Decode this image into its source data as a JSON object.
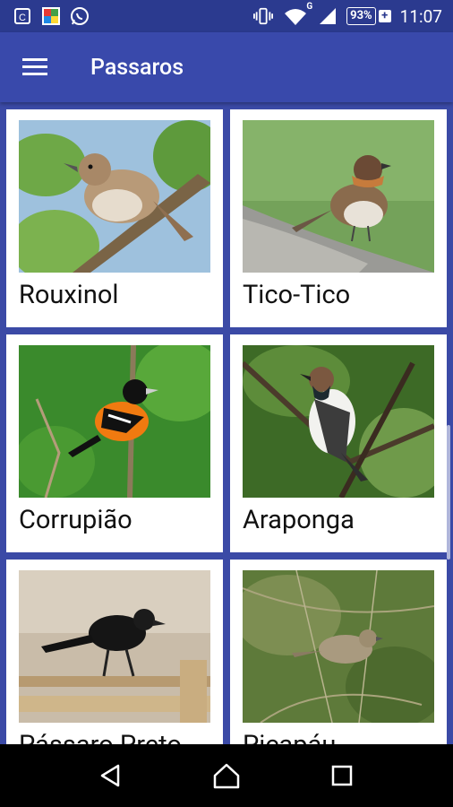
{
  "status_bar": {
    "left_icons": [
      "calendar-notification-icon",
      "gallery-pro-icon",
      "whatsapp-icon"
    ],
    "network_label": "G",
    "battery_percent": "93%",
    "battery_charging_symbol": "+",
    "time": "11:07"
  },
  "app_bar": {
    "menu_icon": "hamburger-menu-icon",
    "title": "Passaros"
  },
  "birds": [
    {
      "name": "Rouxinol"
    },
    {
      "name": "Tico-Tico"
    },
    {
      "name": "Corrupião"
    },
    {
      "name": "Araponga"
    },
    {
      "name": "Pássaro Preto"
    },
    {
      "name": "Picapáu"
    }
  ],
  "colors": {
    "status_bar": "#2b3a8f",
    "app_bar": "#3949ab",
    "list_background": "#3b4aa6",
    "card": "#ffffff"
  },
  "nav_bar": {
    "back_icon": "back-icon",
    "home_icon": "home-icon",
    "recents_icon": "recents-icon"
  }
}
